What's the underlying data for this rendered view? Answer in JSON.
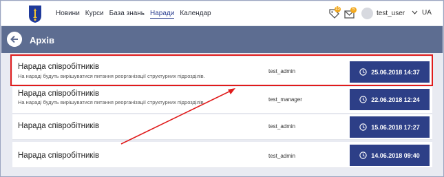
{
  "topbar": {
    "nav": [
      "Новини",
      "Курси",
      "База знань",
      "Наради",
      "Календар"
    ],
    "active_nav_index": 3,
    "notifications_badge": "15",
    "messages_badge": "5",
    "username": "test_user",
    "language": "UA"
  },
  "header": {
    "title": "Архів"
  },
  "meetings": [
    {
      "title": "Нарада співробітників",
      "description": "На нараді будуть вирішуватися питання реорганізації структурних підрозділів.",
      "author": "test_admin",
      "date": "25.06.2018 14:37"
    },
    {
      "title": "Нарада співробітників",
      "description": "На нараді будуть вирішуватися питання реорганізації структурних підрозділів.",
      "author": "test_manager",
      "date": "22.06.2018 12:24"
    },
    {
      "title": "Нарада співробітників",
      "description": "",
      "author": "test_admin",
      "date": "15.06.2018 17:27"
    },
    {
      "title": "Нарада співробітників",
      "description": "",
      "author": "test_admin",
      "date": "14.06.2018 09:40"
    }
  ],
  "colors": {
    "header_bg": "#5d6d91",
    "date_button": "#2d3f87",
    "highlight": "#e01b1b",
    "badge": "#f2a81d"
  }
}
